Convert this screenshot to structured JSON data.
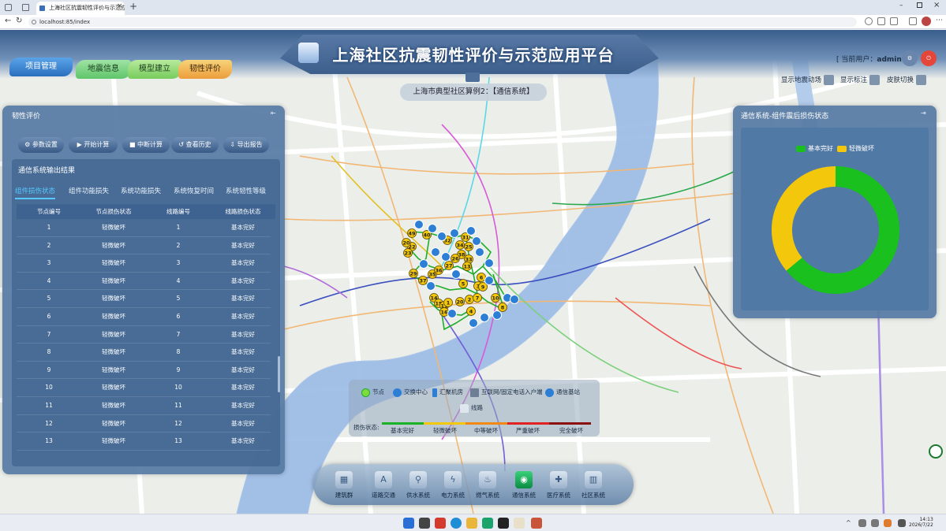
{
  "browser": {
    "tab_title": "上海社区抗震韧性评价与示范应用",
    "url": "localhost:85/index"
  },
  "header": {
    "title": "上海社区抗震韧性评价与示范应用平台",
    "user_prefix": "[ 当前用户：",
    "user_name": "admin",
    "user_suffix": " ]",
    "nav": {
      "project": "项目管理",
      "earthquake": "地震信息",
      "model": "模型建立",
      "resilience": "韧性评价"
    },
    "tools": {
      "show_ground_motion": "显示地震动场",
      "show_labels": "显示标注",
      "skin_switch": "皮肤切换"
    },
    "subtitle": "上海市典型社区算例2：【通信系统】"
  },
  "left_panel": {
    "title": "韧性评价",
    "actions": [
      "参数设置",
      "开始计算",
      "中断计算",
      "查看历史",
      "导出报告"
    ],
    "result_title": "通信系统输出结果",
    "tabs": [
      "组件损伤状态",
      "组件功能损失",
      "系统功能损失",
      "系统恢复时间",
      "系统韧性等级"
    ],
    "columns": [
      "节点编号",
      "节点损伤状态",
      "线路编号",
      "线路损伤状态"
    ],
    "rows": [
      [
        "1",
        "轻微破坏",
        "1",
        "基本完好"
      ],
      [
        "2",
        "轻微破坏",
        "2",
        "基本完好"
      ],
      [
        "3",
        "轻微破坏",
        "3",
        "基本完好"
      ],
      [
        "4",
        "轻微破坏",
        "4",
        "基本完好"
      ],
      [
        "5",
        "轻微破坏",
        "5",
        "基本完好"
      ],
      [
        "6",
        "轻微破坏",
        "6",
        "基本完好"
      ],
      [
        "7",
        "轻微破坏",
        "7",
        "基本完好"
      ],
      [
        "8",
        "轻微破坏",
        "8",
        "基本完好"
      ],
      [
        "9",
        "轻微破坏",
        "9",
        "基本完好"
      ],
      [
        "10",
        "轻微破坏",
        "10",
        "基本完好"
      ],
      [
        "11",
        "轻微破坏",
        "11",
        "基本完好"
      ],
      [
        "12",
        "轻微破坏",
        "12",
        "基本完好"
      ],
      [
        "13",
        "轻微破坏",
        "13",
        "基本完好"
      ]
    ]
  },
  "right_panel": {
    "title": "通信系统-组件震后损伤状态"
  },
  "chart_data": {
    "type": "pie",
    "donut": true,
    "legend_position": "top-center",
    "series": [
      {
        "name": "基本完好",
        "value": 64,
        "color": "#19c01e"
      },
      {
        "name": "轻微破坏",
        "value": 36,
        "color": "#f2c70c"
      }
    ]
  },
  "map_legend": {
    "items": [
      "节点",
      "交换中心",
      "汇聚机房",
      "互联网/固定电话入户端",
      "通信基站",
      "线路"
    ],
    "damage_label": "损伤状态:",
    "damage_levels": [
      {
        "name": "基本完好",
        "color": "#19b325"
      },
      {
        "name": "轻微破坏",
        "color": "#f2c70c"
      },
      {
        "name": "中等破坏",
        "color": "#f08a14"
      },
      {
        "name": "严重破坏",
        "color": "#e02222"
      },
      {
        "name": "完全破坏",
        "color": "#8b1010"
      }
    ]
  },
  "map_nodes": [
    "49",
    "40",
    "22",
    "20",
    "23",
    "32",
    "31",
    "34",
    "25",
    "38",
    "33",
    "27",
    "13",
    "29",
    "37",
    "35",
    "36",
    "26",
    "14",
    "15",
    "11",
    "1",
    "20",
    "2",
    "3",
    "16",
    "4",
    "8",
    "10",
    "5",
    "9",
    "6",
    "7"
  ],
  "dock": [
    "建筑群",
    "道路交通",
    "供水系统",
    "电力系统",
    "燃气系统",
    "通信系统",
    "医疗系统",
    "社区系统"
  ],
  "taskbar": {
    "time": "14:13",
    "date": "2026/7/22"
  }
}
